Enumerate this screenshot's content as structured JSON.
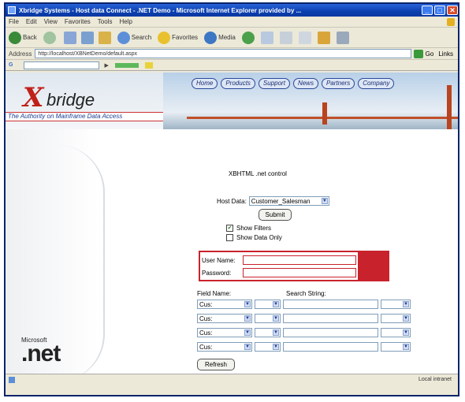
{
  "window": {
    "title": "Xbridge Systems - Host data Connect - .NET Demo - Microsoft Internet Explorer provided by ..."
  },
  "menu": [
    "File",
    "Edit",
    "View",
    "Favorites",
    "Tools",
    "Help"
  ],
  "toolbar": {
    "back_label": "Back",
    "search_label": "Search",
    "favorites_label": "Favorites",
    "media_label": "Media"
  },
  "address": {
    "label": "Address",
    "url": "http://localhost/XBNetDemo/default.aspx"
  },
  "links": {
    "go_label": "Go",
    "links_label": "Links"
  },
  "site": {
    "logo_x": "X",
    "logo_text": "bridge",
    "tagline": "The Authority on Mainframe Data Access",
    "nav": [
      "Home",
      "Products",
      "Support",
      "News",
      "Partners",
      "Company"
    ]
  },
  "form": {
    "title": "XBHTML .net control",
    "host_label": "Host Data:",
    "host_value": "Customer_Salesman",
    "submit_label": "Submit",
    "show_filters_label": "Show Filters",
    "show_filters_checked": true,
    "show_data_only_label": "Show Data Only",
    "show_data_only_checked": false,
    "user_label": "User Name:",
    "password_label": "Password:",
    "field_name_header": "Field Name:",
    "search_string_header": "Search String:",
    "rows": [
      {
        "field": "Cus:"
      },
      {
        "field": "Cus:"
      },
      {
        "field": "Cus:"
      },
      {
        "field": "Cus:"
      }
    ],
    "refresh_label": "Refresh"
  },
  "footer": {
    "ms_label": "Microsoft",
    "net_label": ".net"
  },
  "statusbar": {
    "zone": "Local intranet"
  },
  "colors": {
    "accent_red": "#c8232d",
    "nav_blue": "#1a2d70",
    "titlebar": "#0a3fb0"
  }
}
